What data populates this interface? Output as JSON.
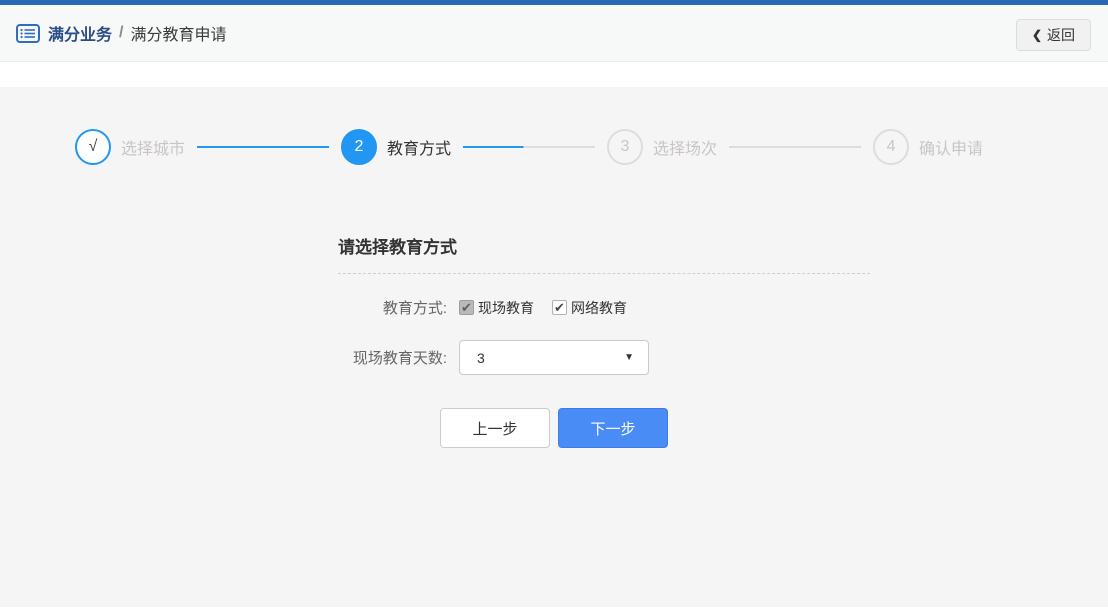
{
  "header": {
    "breadcrumb_primary": "满分业务",
    "breadcrumb_separator": "/",
    "breadcrumb_secondary": "满分教育申请",
    "back_chevron": "❮",
    "back_label": "返回"
  },
  "stepper": {
    "steps": [
      {
        "marker": "√",
        "label": "选择城市",
        "state": "done"
      },
      {
        "marker": "2",
        "label": "教育方式",
        "state": "active"
      },
      {
        "marker": "3",
        "label": "选择场次",
        "state": "pending"
      },
      {
        "marker": "4",
        "label": "确认申请",
        "state": "pending"
      }
    ]
  },
  "form": {
    "title": "请选择教育方式",
    "education_mode": {
      "label": "教育方式:",
      "options": [
        {
          "label": "现场教育",
          "check": "✔",
          "checked": true,
          "disabled": true
        },
        {
          "label": "网络教育",
          "check": "✔",
          "checked": true,
          "disabled": false
        }
      ]
    },
    "onsite_days": {
      "label": "现场教育天数:",
      "value": "3",
      "caret": "▼"
    },
    "buttons": {
      "prev": "上一步",
      "next": "下一步"
    }
  },
  "colors": {
    "topbar_blue": "#2a65b5",
    "brand_blue": "#2d6ec0",
    "step_active_blue": "#2196f3",
    "next_button_blue": "#4a8cf5",
    "panel_gray": "#f5f5f6",
    "inactive_gray": "#c9c5c5"
  }
}
